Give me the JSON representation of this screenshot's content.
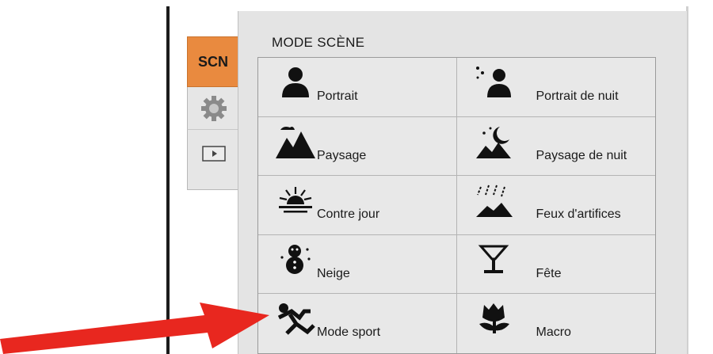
{
  "panel": {
    "title": "MODE SCÈNE"
  },
  "tabs": [
    {
      "label": "SCN",
      "icon": "scene-tab"
    },
    {
      "label": "",
      "icon": "gear-icon"
    },
    {
      "label": "",
      "icon": "playback-icon"
    }
  ],
  "modes": [
    {
      "label": "Portrait",
      "icon": "portrait-icon"
    },
    {
      "label": "Portrait de nuit",
      "icon": "night-portrait-icon"
    },
    {
      "label": "Paysage",
      "icon": "landscape-icon"
    },
    {
      "label": "Paysage de nuit",
      "icon": "night-landscape-icon"
    },
    {
      "label": "Contre jour",
      "icon": "backlight-icon"
    },
    {
      "label": "Feux d'artifices",
      "icon": "fireworks-icon"
    },
    {
      "label": "Neige",
      "icon": "snow-icon"
    },
    {
      "label": "Fête",
      "icon": "party-icon"
    },
    {
      "label": "Mode sport",
      "icon": "sport-icon"
    },
    {
      "label": "Macro",
      "icon": "macro-icon"
    }
  ],
  "colors": {
    "accent_tab": "#e98a3f",
    "arrow": "#e8271f",
    "panel_bg": "#e4e4e4"
  }
}
